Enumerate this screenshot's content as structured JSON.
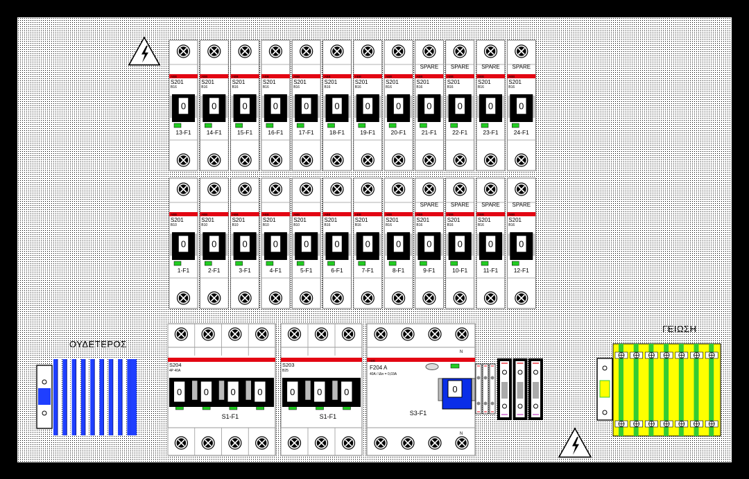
{
  "colors": {
    "abb_red": "#e30613",
    "indicator_green": "#22cc22",
    "rcd_blue": "#0a2ee8",
    "neutral_blue": "#1f3fff",
    "earth_yellow": "#ffff00",
    "earth_green": "#33cc33"
  },
  "icons": [
    "high-voltage-warning-icon",
    "terminal-screw-icon",
    "earth-terminal-icon"
  ],
  "breakers": {
    "brand": "ABB",
    "model": "S201",
    "handle_state": "0",
    "spare_label": "SPARE",
    "top_row": [
      {
        "id": "13-F1",
        "rating": "B16",
        "spare": false
      },
      {
        "id": "14-F1",
        "rating": "B16",
        "spare": false
      },
      {
        "id": "15-F1",
        "rating": "B16",
        "spare": false
      },
      {
        "id": "16-F1",
        "rating": "B16",
        "spare": false
      },
      {
        "id": "17-F1",
        "rating": "B16",
        "spare": false
      },
      {
        "id": "18-F1",
        "rating": "B16",
        "spare": false
      },
      {
        "id": "19-F1",
        "rating": "B16",
        "spare": false
      },
      {
        "id": "20-F1",
        "rating": "B16",
        "spare": false
      },
      {
        "id": "21-F1",
        "rating": "B16",
        "spare": true
      },
      {
        "id": "22-F1",
        "rating": "B16",
        "spare": true
      },
      {
        "id": "23-F1",
        "rating": "B16",
        "spare": true
      },
      {
        "id": "24-F1",
        "rating": "B16",
        "spare": true
      }
    ],
    "bottom_row": [
      {
        "id": "1-F1",
        "rating": "B10",
        "spare": false
      },
      {
        "id": "2-F1",
        "rating": "B10",
        "spare": false
      },
      {
        "id": "3-F1",
        "rating": "B10",
        "spare": false
      },
      {
        "id": "4-F1",
        "rating": "B10",
        "spare": false
      },
      {
        "id": "5-F1",
        "rating": "B10",
        "spare": false
      },
      {
        "id": "6-F1",
        "rating": "B16",
        "spare": false
      },
      {
        "id": "7-F1",
        "rating": "B16",
        "spare": false
      },
      {
        "id": "8-F1",
        "rating": "B16",
        "spare": false
      },
      {
        "id": "9-F1",
        "rating": "B16",
        "spare": true
      },
      {
        "id": "10-F1",
        "rating": "B16",
        "spare": true
      },
      {
        "id": "11-F1",
        "rating": "B16",
        "spare": true
      },
      {
        "id": "12-F1",
        "rating": "B16",
        "spare": true
      }
    ]
  },
  "main_devices": [
    {
      "model": "S204",
      "rating": "4P 40A",
      "poles": 4,
      "id": "S1-F1",
      "handle_state": "0"
    },
    {
      "model": "S203",
      "rating": "B25",
      "poles": 3,
      "id": "S1-F1",
      "handle_state": "0"
    },
    {
      "model": "F204 A",
      "rating": "40A / IΔn = 0,03A",
      "poles": 4,
      "id": "S3-F1",
      "handle_state": "0",
      "brand": "ABB",
      "marking": "N"
    }
  ],
  "bars": {
    "neutral_label": "ΟΥΔΕΤΕΡΟΣ",
    "earth_label": "ΓΕΙΩΣΗ"
  }
}
